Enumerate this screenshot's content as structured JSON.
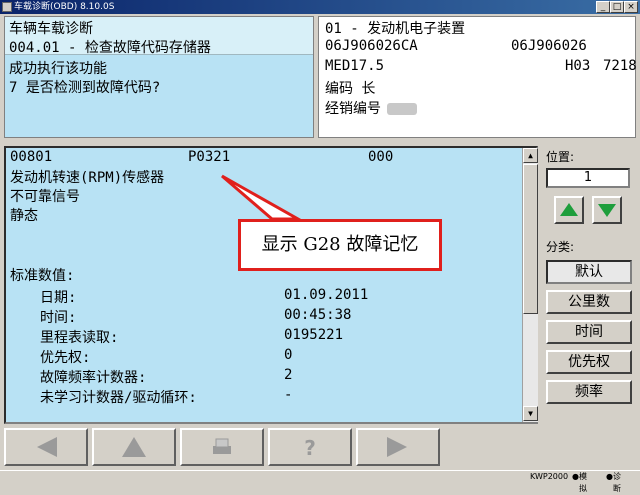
{
  "window": {
    "title": "车载诊断(OBD) 8.10.0S"
  },
  "top_left": {
    "title": "车辆车载诊断",
    "subtitle": "004.01 - 检查故障代码存储器",
    "status": "成功执行该功能",
    "question": "7 是否检测到故障代码?"
  },
  "top_right": {
    "module": "01 - 发动机电子装置",
    "part_no_1": "06J906026CA",
    "part_no_2": "06J906026",
    "ecu": "MED17.5",
    "ecu_code": "H03",
    "ecu_num": "7218",
    "coding": "编码 长",
    "dealer": "经销编号"
  },
  "fault": {
    "code": "00801",
    "pcode": "P0321",
    "status_code": "000",
    "desc": "发动机转速(RPM)传感器",
    "type": "不可靠信号",
    "state": "静态",
    "std_label": "标准数值:",
    "rows": [
      {
        "label": "日期:",
        "value": "01.09.2011"
      },
      {
        "label": "时间:",
        "value": "00:45:38"
      },
      {
        "label": "里程表读取:",
        "value": "0195221"
      },
      {
        "label": "优先权:",
        "value": "0"
      },
      {
        "label": "故障频率计数器:",
        "value": "2"
      },
      {
        "label": "未学习计数器/驱动循环:",
        "value": "-"
      }
    ]
  },
  "callout": {
    "text": "显示 G28 故障记忆"
  },
  "side": {
    "position_label": "位置:",
    "position_value": "1",
    "category_label": "分类:",
    "categories": [
      "默认",
      "公里数",
      "时间",
      "优先权",
      "频率"
    ]
  },
  "status_bar": {
    "app": "KWP2000",
    "item1": "模拟",
    "item2": "诊断"
  },
  "colors": {
    "panel_bg": "#b8e2f4",
    "callout_border": "#e0201c",
    "nav_arrow": "#1e9e3c"
  },
  "icons": [
    "back-arrow-icon",
    "up-arrow-icon",
    "print-icon",
    "help-icon",
    "forward-arrow-icon"
  ]
}
